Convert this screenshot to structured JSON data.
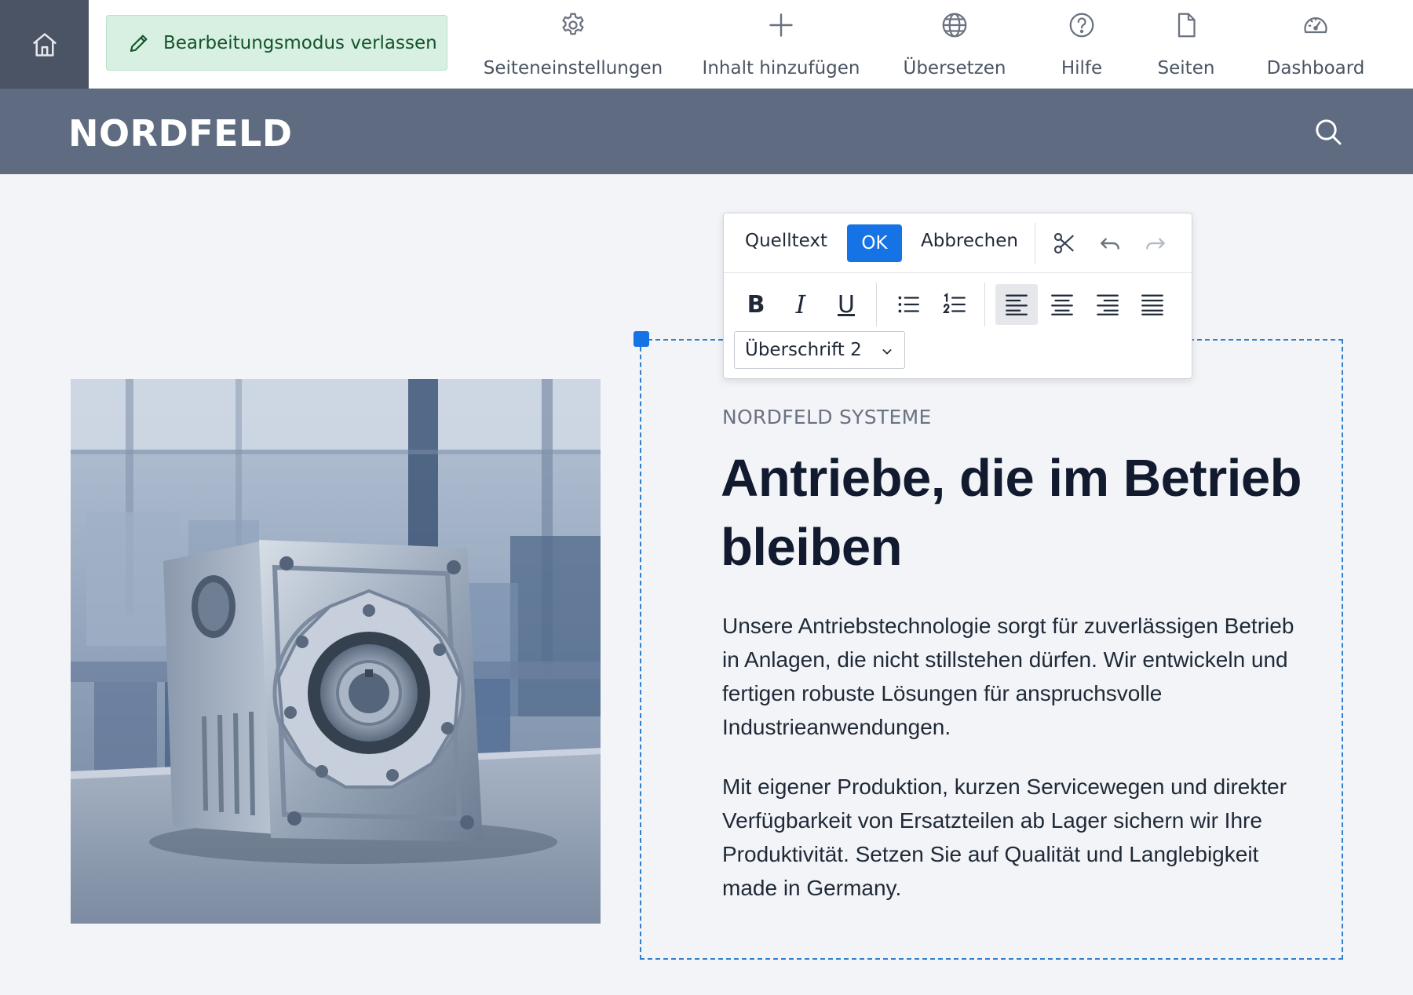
{
  "admin_bar": {
    "home_label": "",
    "exit_edit_label": "Bearbeitungsmodus verlassen",
    "tools": [
      {
        "label": "Seiteneinstellungen",
        "icon": "gear-icon"
      },
      {
        "label": "Inhalt hinzufügen",
        "icon": "plus-icon"
      },
      {
        "label": "Übersetzen",
        "icon": "globe-icon"
      },
      {
        "label": "Hilfe",
        "icon": "help-icon"
      },
      {
        "label": "Seiten",
        "icon": "page-icon"
      },
      {
        "label": "Dashboard",
        "icon": "gauge-icon"
      }
    ]
  },
  "site": {
    "logo": "NORDFELD",
    "search_icon": "search-icon"
  },
  "editor": {
    "source_label": "Quelltext",
    "ok_label": "OK",
    "cancel_label": "Abbrechen",
    "bold": "B",
    "italic": "I",
    "underline": "U",
    "block_format": "Überschrift 2",
    "active_alignment": "left"
  },
  "content": {
    "eyebrow": "NORDFELD SYSTEME",
    "headline": "Antriebe, die im Betrieb bleiben",
    "paragraph_1": "Unsere Antriebstechnologie sorgt für zuverlässigen Betrieb in Anlagen, die nicht stillstehen dürfen. Wir entwickeln und fertigen robuste Lösungen für anspruchsvolle Industrieanwendungen.",
    "paragraph_2": "Mit eigener Produktion, kurzen Servicewegen und direkter Verfügbarkeit von Ersatzteilen ab Lager sichern wir Ihre Produktivität. Setzen Sie auf Qualität und Langlebigkeit made in Germany."
  },
  "colors": {
    "admin_home_bg": "#4b5464",
    "exit_edit_bg": "#d8f0e1",
    "site_header_bg": "#5f6b80",
    "ok_button": "#1673e6",
    "selection_border": "#2f7fce"
  }
}
